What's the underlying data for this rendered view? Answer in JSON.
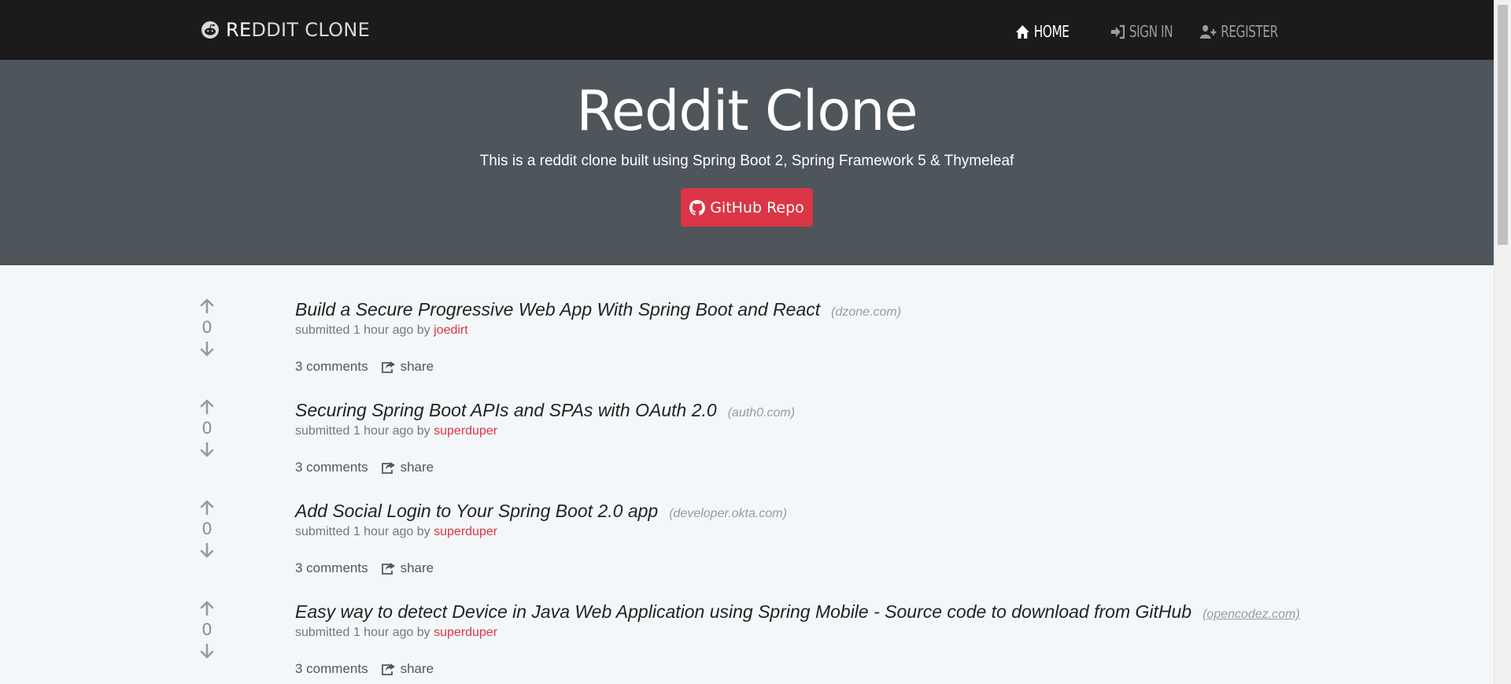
{
  "navbar": {
    "brand": {
      "prefix": "RE",
      "rest": "DDIT CLONE"
    },
    "links": [
      {
        "label": "HOME",
        "icon": "home-icon",
        "active": true
      },
      {
        "label": "SIGN IN",
        "icon": "sign-in-icon",
        "active": false
      },
      {
        "label": "REGISTER",
        "icon": "user-plus-icon",
        "active": false
      }
    ]
  },
  "hero": {
    "title": "Reddit Clone",
    "subtitle": "This is a reddit clone built using Spring Boot 2, Spring Framework 5 & Thymeleaf",
    "button_label": "GitHub Repo"
  },
  "posts": [
    {
      "votes": "0",
      "title": "Build a Secure Progressive Web App With Spring Boot and React",
      "domain": "(dzone.com)",
      "submitted": "submitted 1 hour ago by",
      "author": "joedirt",
      "comments": "3 comments",
      "share": "share"
    },
    {
      "votes": "0",
      "title": "Securing Spring Boot APIs and SPAs with OAuth 2.0",
      "domain": "(auth0.com)",
      "submitted": "submitted 1 hour ago by",
      "author": "superduper",
      "comments": "3 comments",
      "share": "share"
    },
    {
      "votes": "0",
      "title": "Add Social Login to Your Spring Boot 2.0 app",
      "domain": "(developer.okta.com)",
      "submitted": "submitted 1 hour ago by",
      "author": "superduper",
      "comments": "3 comments",
      "share": "share"
    },
    {
      "votes": "0",
      "title": "Easy way to detect Device in Java Web Application using Spring Mobile - Source code to download from GitHub",
      "domain": "(opencodez.com)",
      "submitted": "submitted 1 hour ago by",
      "author": "superduper",
      "comments": "3 comments",
      "share": "share"
    }
  ],
  "colors": {
    "navbar_bg": "#1b1b1b",
    "hero_bg": "#4e555b",
    "accent_red": "#dc3545",
    "page_bg": "#f4f7f9"
  }
}
